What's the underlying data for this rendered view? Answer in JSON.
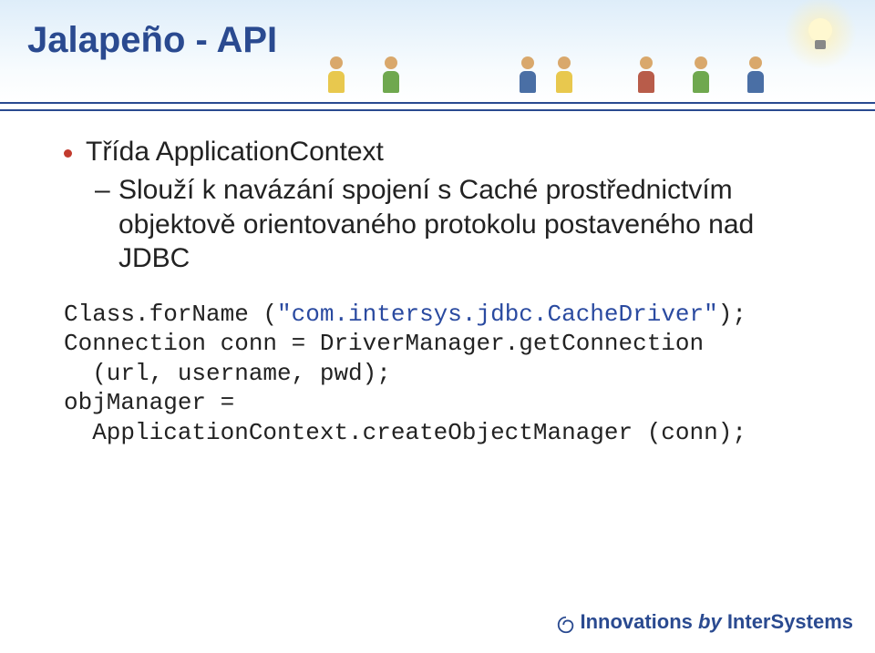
{
  "title": "Jalapeño - API",
  "bullets": {
    "l1": "Třída ApplicationContext",
    "l2": "Slouží k navázání spojení s Caché prostřednictvím objektově orientovaného protokolu postaveného nad JDBC"
  },
  "code": {
    "line1a": "Class.forName (",
    "line1b": "\"com.intersys.jdbc.CacheDriver\"",
    "line1c": ");",
    "line2": "Connection conn = DriverManager.getConnection",
    "line3": "  (url, username, pwd);",
    "line4": "objManager =",
    "line5": "  ApplicationContext.createObjectManager (conn);"
  },
  "footer": {
    "innov": "Innovations",
    "by": " by ",
    "brand": "InterSystems"
  }
}
